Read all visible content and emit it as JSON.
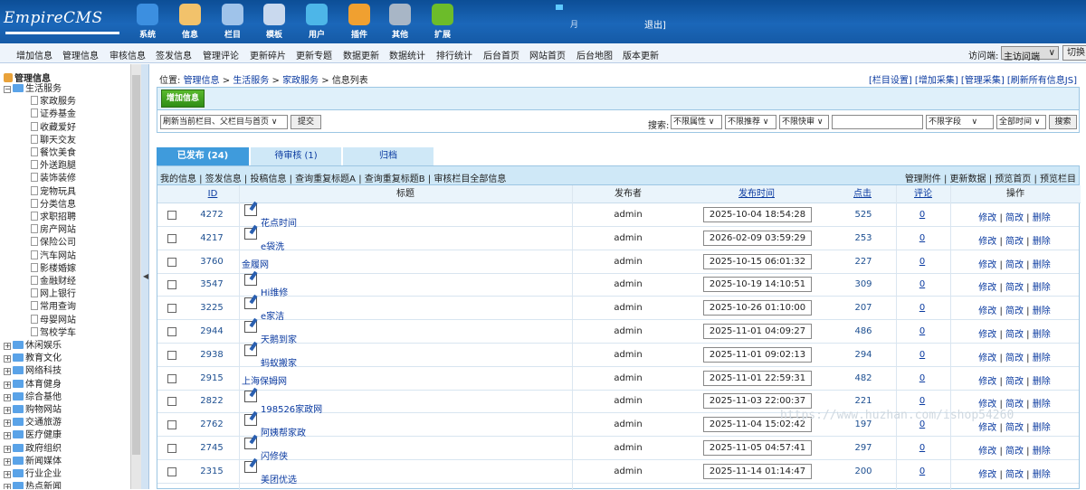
{
  "header": {
    "logo": "EmpireCMS",
    "nav": [
      {
        "label": "系统",
        "icon": "globe-icon",
        "color": "#3c8fe0"
      },
      {
        "label": "信息",
        "icon": "edit-icon",
        "color": "#f2c26b"
      },
      {
        "label": "栏目",
        "icon": "folder-icon",
        "color": "#9fc3ea"
      },
      {
        "label": "模板",
        "icon": "window-icon",
        "color": "#c9d9ee"
      },
      {
        "label": "用户",
        "icon": "user-icon",
        "color": "#4db6e8"
      },
      {
        "label": "插件",
        "icon": "tools-icon",
        "color": "#f0a030"
      },
      {
        "label": "其他",
        "icon": "gear-icon",
        "color": "#a8b6c6"
      },
      {
        "label": "扩展",
        "icon": "plus-icon",
        "color": "#6cbc2a"
      }
    ],
    "user_tag": "月",
    "logout": "退出]"
  },
  "menu": {
    "items": [
      "增加信息",
      "管理信息",
      "审核信息",
      "签发信息",
      "管理评论",
      "更新碎片",
      "更新专题",
      "数据更新",
      "数据统计",
      "排行统计",
      "后台首页",
      "网站首页",
      "后台地图",
      "版本更新"
    ],
    "visit_label": "访问端:",
    "visit_value": "主访问端",
    "switch_label": "切换"
  },
  "sidebar": {
    "title": "管理信息",
    "open_group": "生活服务",
    "children": [
      "家政服务",
      "证券基金",
      "收藏爱好",
      "聊天交友",
      "餐饮美食",
      "外送跑腿",
      "装饰装修",
      "宠物玩具",
      "分类信息",
      "求职招聘",
      "房产网站",
      "保险公司",
      "汽车网站",
      "影楼婚嫁",
      "金融财经",
      "网上银行",
      "常用查询",
      "母婴网站",
      "驾校学车"
    ],
    "groups": [
      "休闲娱乐",
      "教育文化",
      "网络科技",
      "体育健身",
      "综合基他",
      "购物网站",
      "交通旅游",
      "医疗健康",
      "政府组织",
      "新闻媒体",
      "行业企业",
      "热点新闻"
    ]
  },
  "breadcrumb": {
    "prefix": "位置:",
    "path": [
      "管理信息",
      "生活服务",
      "家政服务",
      "信息列表"
    ],
    "right": "[栏目设置] [增加采集] [管理采集] [刷新所有信息JS]"
  },
  "toolbar": {
    "add_label": "增加信息",
    "refresh_option": "刷新当前栏目、父栏目与首页",
    "submit_label": "提交",
    "search_label": "搜索:",
    "filters": [
      "不限属性",
      "不限推荐",
      "不限快审"
    ],
    "field": "不限字段",
    "time": "全部时间",
    "search_button": "搜索"
  },
  "tabs": [
    {
      "label": "已发布 (24)",
      "active": true
    },
    {
      "label": "待审核 (1)",
      "active": false
    },
    {
      "label": "归档",
      "active": false
    }
  ],
  "subbar": {
    "left": "我的信息 | 签发信息 | 投稿信息 | 查询重复标题A | 查询重复标题B | 审核栏目全部信息",
    "right": "管理附件 | 更新数据 | 预览首页 | 预览栏目"
  },
  "columns": {
    "id": "ID",
    "title": "标题",
    "poster": "发布者",
    "time": "发布时间",
    "hits": "点击",
    "comments": "评论",
    "ops": "操作"
  },
  "rows": [
    {
      "id": "4272",
      "title": "花点时间",
      "icon": true,
      "poster": "admin",
      "time": "2025-10-04 18:54:28",
      "hits": "525",
      "comments": "0"
    },
    {
      "id": "4217",
      "title": "e袋洗",
      "icon": true,
      "poster": "admin",
      "time": "2026-02-09 03:59:29",
      "hits": "253",
      "comments": "0"
    },
    {
      "id": "3760",
      "title": "金履网",
      "icon": false,
      "poster": "admin",
      "time": "2025-10-15 06:01:32",
      "hits": "227",
      "comments": "0"
    },
    {
      "id": "3547",
      "title": "Hi维修",
      "icon": true,
      "poster": "admin",
      "time": "2025-10-19 14:10:51",
      "hits": "309",
      "comments": "0"
    },
    {
      "id": "3225",
      "title": "e家洁",
      "icon": true,
      "poster": "admin",
      "time": "2025-10-26 01:10:00",
      "hits": "207",
      "comments": "0"
    },
    {
      "id": "2944",
      "title": "天鹅到家",
      "icon": true,
      "poster": "admin",
      "time": "2025-11-01 04:09:27",
      "hits": "486",
      "comments": "0"
    },
    {
      "id": "2938",
      "title": "蚂蚁搬家",
      "icon": true,
      "poster": "admin",
      "time": "2025-11-01 09:02:13",
      "hits": "294",
      "comments": "0"
    },
    {
      "id": "2915",
      "title": "上海保姆网",
      "icon": false,
      "poster": "admin",
      "time": "2025-11-01 22:59:31",
      "hits": "482",
      "comments": "0"
    },
    {
      "id": "2822",
      "title": "198526家政网",
      "icon": true,
      "poster": "admin",
      "time": "2025-11-03 22:00:37",
      "hits": "221",
      "comments": "0"
    },
    {
      "id": "2762",
      "title": "阿姨帮家政",
      "icon": true,
      "poster": "admin",
      "time": "2025-11-04 15:02:42",
      "hits": "197",
      "comments": "0"
    },
    {
      "id": "2745",
      "title": "闪修侠",
      "icon": true,
      "poster": "admin",
      "time": "2025-11-05 04:57:41",
      "hits": "297",
      "comments": "0"
    },
    {
      "id": "2315",
      "title": "美团优选",
      "icon": true,
      "poster": "admin",
      "time": "2025-11-14 01:14:47",
      "hits": "200",
      "comments": "0"
    }
  ],
  "row_ops": {
    "edit": "修改",
    "quick": "简改",
    "del": "删除"
  },
  "watermark": "https://www.huzhan.com/ishop54260"
}
